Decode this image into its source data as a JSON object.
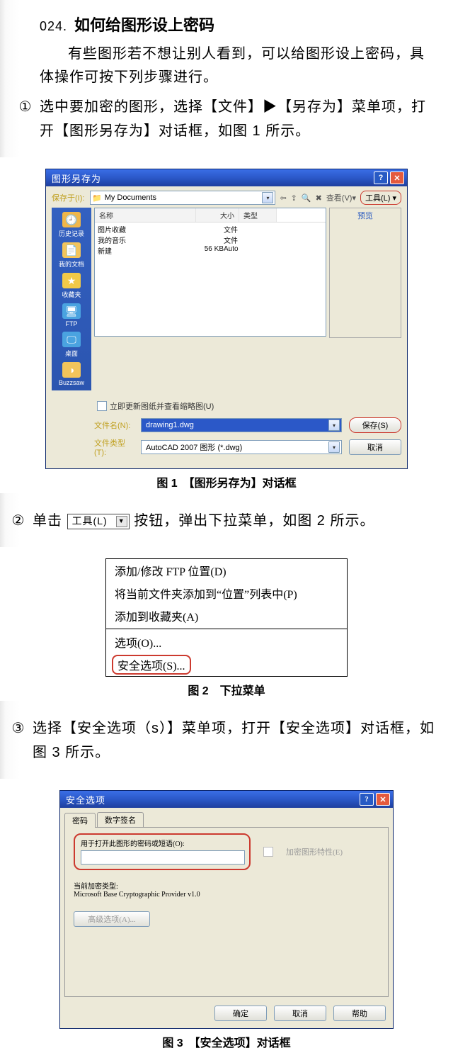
{
  "topic": {
    "num": "024.",
    "title": "如何给图形设上密码"
  },
  "intro": "有些图形若不想让别人看到，可以给图形设上密码，具体操作可按下列步骤进行。",
  "steps": {
    "s1": {
      "num": "①",
      "text": "选中要加密的图形，选择【文件】▶【另存为】菜单项，打开【图形另存为】对话框，如图 1 所示。"
    },
    "s2": {
      "num": "②",
      "prefix": "单击",
      "btn_label": "工具(L)",
      "suffix": "按钮，弹出下拉菜单，如图 2 所示。"
    },
    "s3": {
      "num": "③",
      "text": "选择【安全选项（s）】菜单项，打开【安全选项】对话框，如图 3 所示。"
    }
  },
  "captions": {
    "c1": "图 1　【图形另存为】对话框",
    "c2": "图 2　下拉菜单",
    "c3": "图 3　【安全选项】对话框"
  },
  "dlg1": {
    "title": "图形另存为",
    "save_in_label": "保存于(I):",
    "save_in_value": "My Documents",
    "tools_label": "工具(L)",
    "view_label": "查看(V)",
    "preview_label": "预览",
    "sidebar": [
      "历史记录",
      "我的文档",
      "收藏夹",
      "FTP",
      "桌面",
      "Buzzsaw"
    ],
    "cols": {
      "name": "名称",
      "size": "大小",
      "type": "类型"
    },
    "rows": [
      {
        "name": "图片收藏",
        "size": "",
        "type": "文件"
      },
      {
        "name": "我的音乐",
        "size": "",
        "type": "文件"
      },
      {
        "name": "新建",
        "size": "56 KB",
        "type": "Auto"
      }
    ],
    "chk_label": "立即更新图纸并查看缩略图(U)",
    "filename_label": "文件名(N):",
    "filename_value": "drawing1.dwg",
    "filetype_label": "文件类型(T):",
    "filetype_value": "AutoCAD 2007 图形 (*.dwg)",
    "save_btn": "保存(S)",
    "cancel_btn": "取消"
  },
  "menu2": {
    "i1": "添加/修改 FTP 位置(D)",
    "i2": "将当前文件夹添加到“位置”列表中(P)",
    "i3": "添加到收藏夹(A)",
    "i4": "选项(O)...",
    "i5": "安全选项(S)..."
  },
  "dlg3": {
    "title": "安全选项",
    "tab1": "密码",
    "tab2": "数字签名",
    "pw_label": "用于打开此图形的密码或短语(O):",
    "encrypt_chk": "加密图形特性(E)",
    "provider_hint": "当前加密类型:",
    "provider": "Microsoft Base Cryptographic Provider v1.0",
    "adv_btn": "高级选项(A)...",
    "ok": "确定",
    "cancel": "取消",
    "help": "帮助"
  }
}
